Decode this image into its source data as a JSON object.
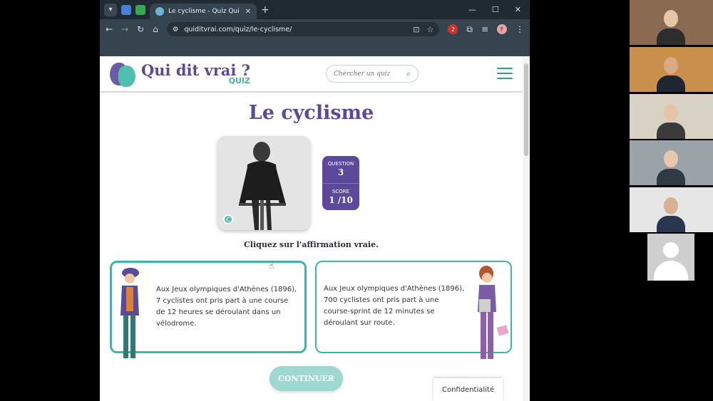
{
  "browser": {
    "tab_title": "Le cyclisme - Quiz Qui dit vrai?",
    "url": "quiditvrai.com/quiz/le-cyclisme/",
    "ext_badge": "2",
    "profile_initial": "F"
  },
  "site": {
    "logo_title": "Qui dit vrai ?",
    "logo_sub": "QUIZ",
    "search_placeholder": "Chercher un quiz"
  },
  "quiz": {
    "title": "Le cyclisme",
    "question_label": "QUESTION",
    "question_number": "3",
    "score_label": "SCORE",
    "score_value": "1 /10",
    "instruction": "Cliquez sur l'affirmation vraie.",
    "photo_credit": "C",
    "options": [
      {
        "text": "Aux Jeux olympiques d'Athènes (1896), 7 cyclistes ont pris part à une course de 12 heures se déroulant dans un vélodrome."
      },
      {
        "text": "Aux Jeux olympiques d'Athènes (1896), 700 cyclistes ont pris part à une course-sprint de 12 minutes se déroulant sur route."
      }
    ],
    "continue_label": "CONTINUER",
    "privacy_label": "Confidentialité"
  },
  "colors": {
    "brand_purple": "#5b4a9c",
    "brand_teal": "#3fb5a5"
  }
}
